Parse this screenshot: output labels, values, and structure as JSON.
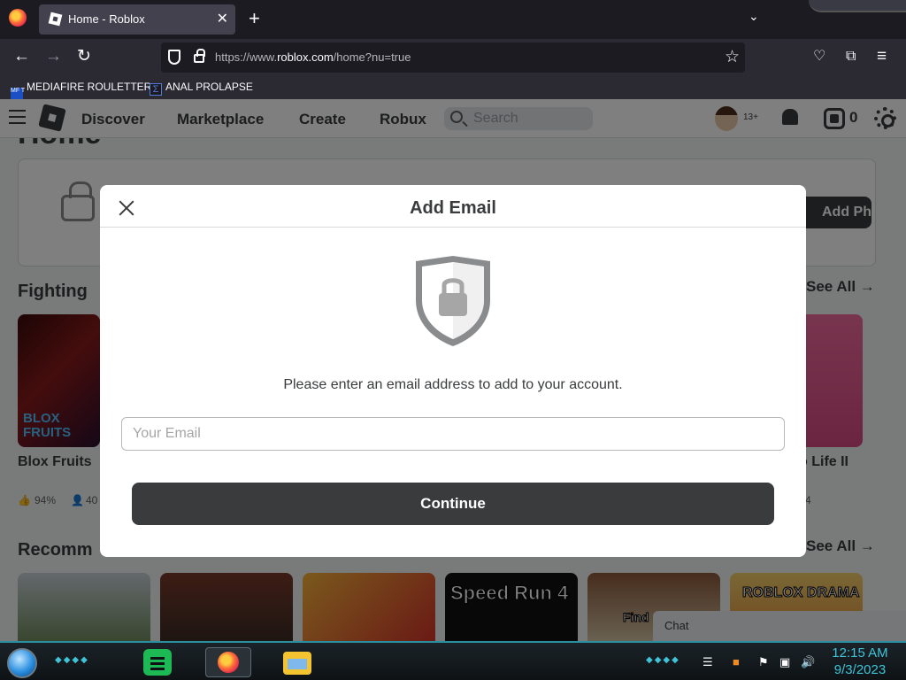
{
  "browser": {
    "tab": {
      "title": "Home - Roblox",
      "close_glyph": "✕"
    },
    "new_tab_glyph": "+",
    "tab_list_glyph": "⌄",
    "nav": {
      "back_glyph": "←",
      "forward_glyph": "→",
      "reload_glyph": "↻"
    },
    "url": {
      "prefix": "https://www.",
      "domain": "roblox.com",
      "path": "/home?nu=true"
    },
    "bookmark_star_glyph": "☆",
    "toolbar_icons": [
      "pocket-icon",
      "extensions-icon",
      "menu-icon"
    ],
    "menu_glyph": "≡",
    "bookmarks": [
      {
        "label": "MEDIAFIRE ROULETTER",
        "icon_text": "MF T"
      },
      {
        "label": "ANAL PROLAPSE",
        "icon_text": "Σ"
      }
    ]
  },
  "roblox": {
    "nav_items": [
      "Discover",
      "Marketplace",
      "Create",
      "Robux"
    ],
    "search_placeholder": "Search",
    "age_badge": "13+",
    "robux_count": "0",
    "page_title": "Home",
    "banner_button_partial": "Add Phone",
    "sections": [
      {
        "title": "Fighting",
        "see_all": "See All →"
      },
      {
        "title": "Recomm",
        "see_all": "See All →"
      }
    ],
    "games": [
      {
        "name": "Blox Fruits",
        "tile_text": "BLOX FRUITS",
        "rating": "94%",
        "players": "40"
      },
      {
        "name": "o Life II",
        "players": "4"
      }
    ],
    "recommended_tiles": [
      {
        "text": ""
      },
      {
        "text": ""
      },
      {
        "text": ""
      },
      {
        "text": "Speed Run 4"
      },
      {
        "text": "Find"
      },
      {
        "text": "ROBLOX DRAMA"
      }
    ],
    "chat_label": "Chat"
  },
  "modal": {
    "title": "Add Email",
    "message": "Please enter an email address to add to your account.",
    "input_placeholder": "Your Email",
    "input_value": "",
    "continue_label": "Continue"
  },
  "taskbar": {
    "time": "12:15 AM",
    "date": "9/3/2023"
  },
  "colors": {
    "roblox_dark": "#393b3d",
    "overlay": "rgba(0,0,0,0.5)",
    "taskbar_accent": "#3fc3d8"
  }
}
